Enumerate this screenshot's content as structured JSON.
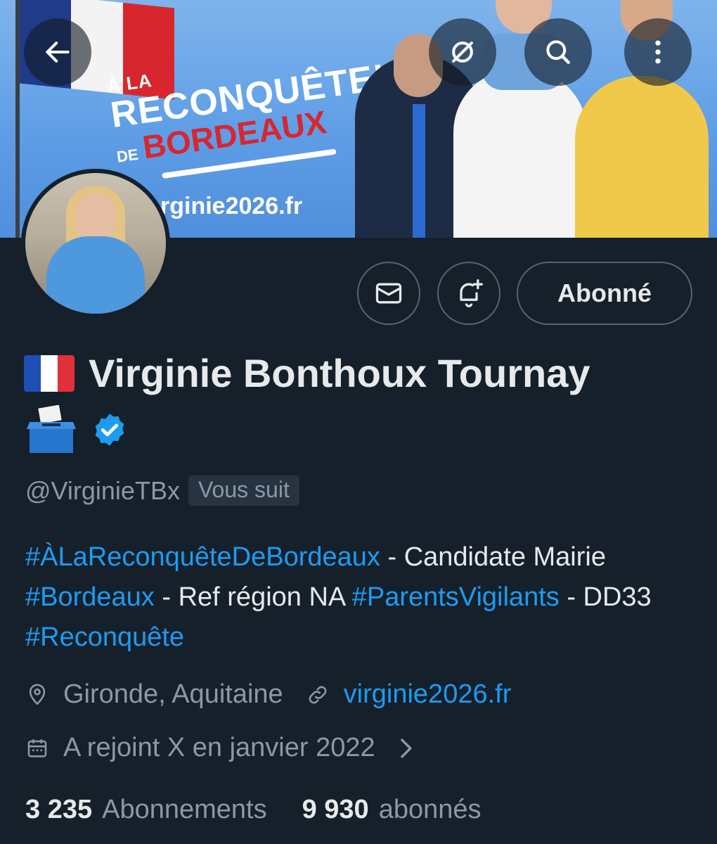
{
  "banner": {
    "slogan_line1": "À LA",
    "slogan_line2": "RECONQUÊTE!",
    "slogan_line3_prefix": "DE",
    "slogan_line3": "BORDEAUX",
    "url_text": "rginie2026.fr"
  },
  "top_bar": {
    "back_icon": "arrow-left-icon",
    "grok_icon": "grok-icon",
    "search_icon": "search-icon",
    "more_icon": "more-vertical-icon"
  },
  "actions": {
    "message_icon": "envelope-icon",
    "notify_icon": "bell-plus-icon",
    "follow_label": "Abonné"
  },
  "profile": {
    "display_name": "Virginie Bonthoux Tournay",
    "handle": "@VirginieTBx",
    "follows_you": "Vous suit",
    "bio": {
      "tag1": "#ÀLaReconquêteDeBordeaux",
      "text1": " - Candidate Mairie ",
      "tag2": "#Bordeaux",
      "text2": " - Ref région NA ",
      "tag3": "#ParentsVigilants",
      "text3": " - DD33 ",
      "tag4": "#Reconquête"
    },
    "location": "Gironde, Aquitaine",
    "website": "virginie2026.fr",
    "joined": "A rejoint X en janvier 2022",
    "following_count": "3 235",
    "following_label": "Abonnements",
    "followers_count": "9 930",
    "followers_label": "abonnés"
  },
  "colors": {
    "background": "#15202b",
    "accent": "#1d9bf0",
    "muted": "#8b98a5",
    "text": "#e7e9ea"
  }
}
